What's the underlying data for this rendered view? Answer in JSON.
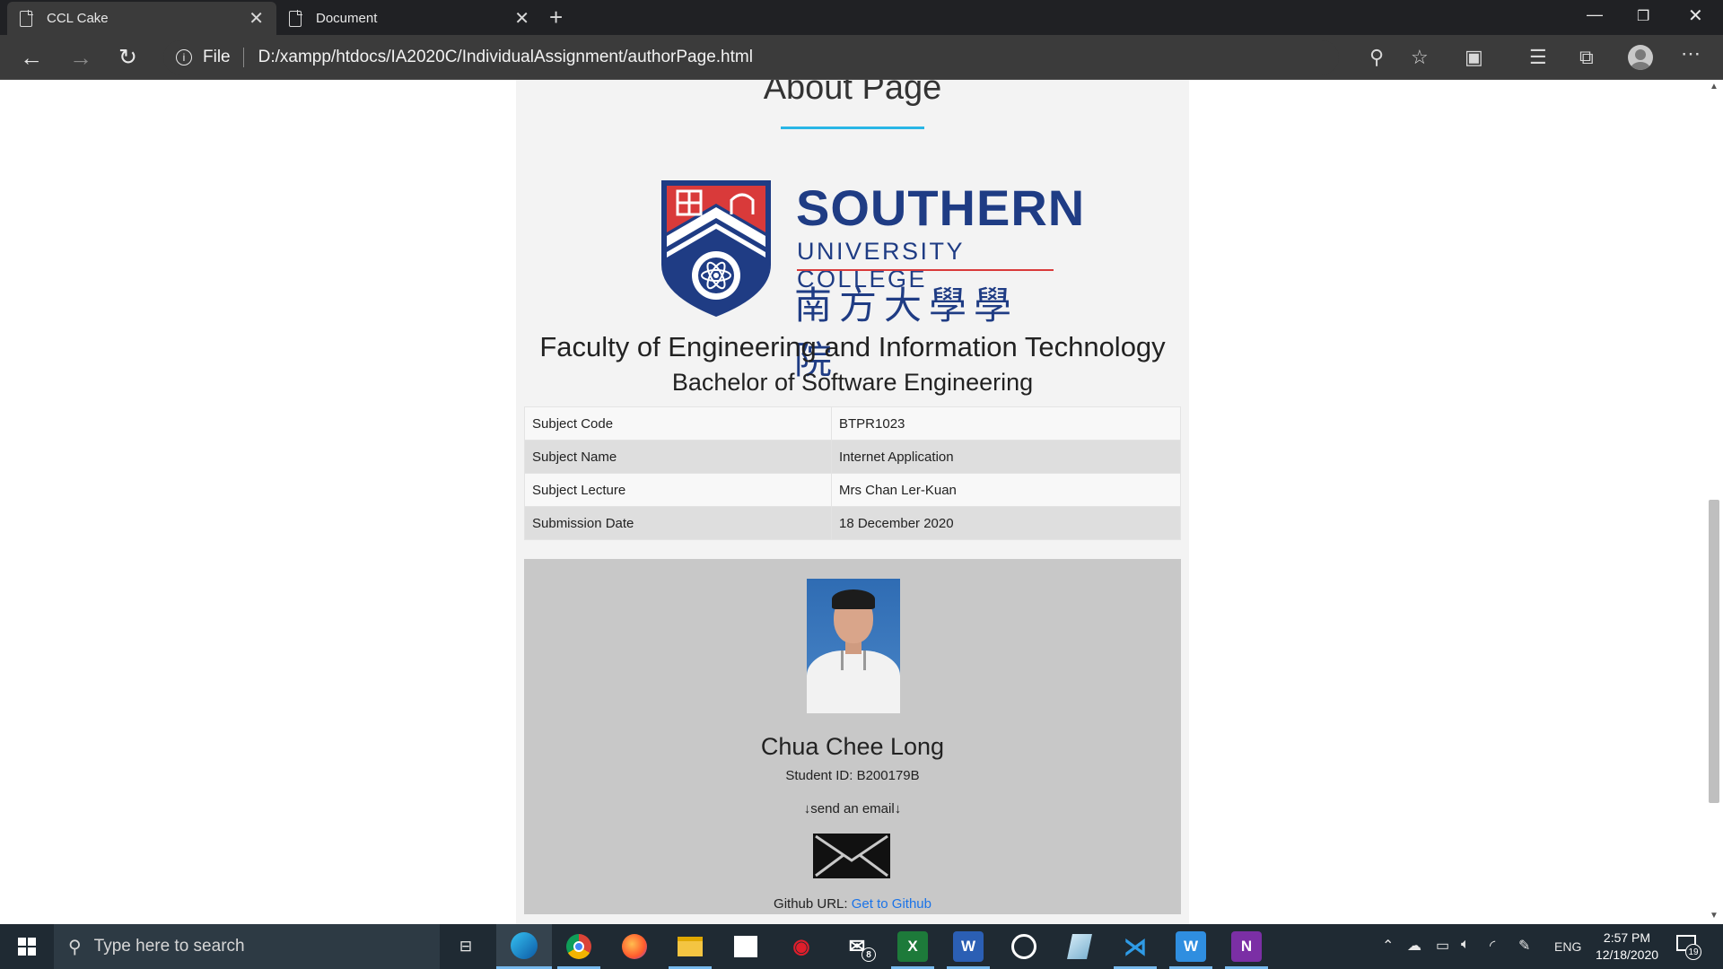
{
  "browser": {
    "tabs": [
      {
        "title": "CCL Cake",
        "active": true
      },
      {
        "title": "Document",
        "active": false
      }
    ],
    "address": {
      "scheme": "File",
      "url": "D:/xampp/htdocs/IA2020C/IndividualAssignment/authorPage.html"
    }
  },
  "page": {
    "title": "About Page",
    "logo": {
      "main": "SOUTHERN",
      "sub": "UNIVERSITY COLLEGE",
      "cjk": "南方大學學院"
    },
    "faculty": "Faculty of Engineering and Information Technology",
    "programme": "Bachelor of Software Engineering",
    "info_rows": [
      {
        "label": "Subject Code",
        "value": "BTPR1023"
      },
      {
        "label": "Subject Name",
        "value": "Internet Application"
      },
      {
        "label": "Subject Lecture",
        "value": "Mrs Chan Ler-Kuan"
      },
      {
        "label": "Submission Date",
        "value": "18 December 2020"
      }
    ],
    "author": {
      "name": "Chua Chee Long",
      "student_id": "Student ID: B200179B",
      "email_prompt": "↓send an email↓",
      "github_label": "Github URL:",
      "github_link": "Get to Github"
    }
  },
  "taskbar": {
    "search_placeholder": "Type here to search",
    "mail_badge": "8",
    "language": "ENG",
    "time": "2:57 PM",
    "date": "12/18/2020",
    "notification_count": "19"
  },
  "colors": {
    "accent_rule": "#29b6e6",
    "logo_blue": "#1f3c84",
    "logo_red": "#d93a3a",
    "link": "#1a73e8"
  }
}
